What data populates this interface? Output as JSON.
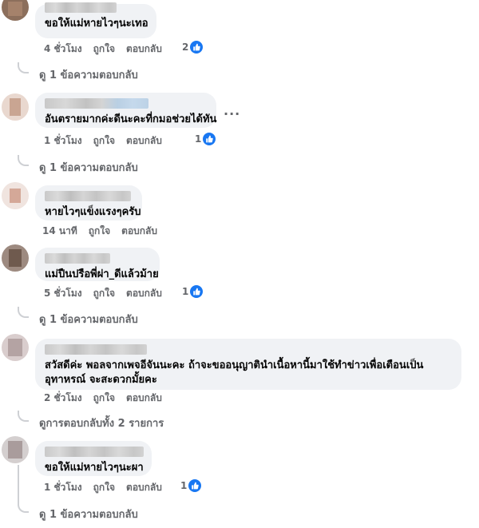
{
  "comments": [
    {
      "text": "ขอให้แม่หายไวๆนะเทอ",
      "time": "4 ชั่วโมง",
      "like": "ถูกใจ",
      "reply": "ตอบกลับ",
      "reaction_count": "2",
      "view_replies": "ดู 1 ข้อความตอบกลับ"
    },
    {
      "text": "อันตรายมากค่ะดีนะคะที่กมอช่วยได้ทัน",
      "time": "1 ชั่วโมง",
      "like": "ถูกใจ",
      "reply": "ตอบกลับ",
      "reaction_count": "1",
      "view_replies": "ดู 1 ข้อความตอบกลับ",
      "more": "···"
    },
    {
      "text": "หายไวๆแข็งแรงๆครับ",
      "time": "14 นาที",
      "like": "ถูกใจ",
      "reply": "ตอบกลับ"
    },
    {
      "text": "แม่ปืนปรือพี่ผ่า_ดีแล้วม้าย",
      "time": "5 ชั่วโมง",
      "like": "ถูกใจ",
      "reply": "ตอบกลับ",
      "reaction_count": "1",
      "view_replies": "ดู 1 ข้อความตอบกลับ"
    },
    {
      "text": "สวัสดีค่ะ พอลจากเพจอีจันนะคะ ถ้าจะขออนุญาตินำเนื้อหานี้มาใช้ทำข่าวเพื่อเตือนเป็นอุทาหรณ์ จะสะดวกมั้ยคะ",
      "time": "2 ชั่วโมง",
      "like": "ถูกใจ",
      "reply": "ตอบกลับ",
      "view_replies": "ดูการตอบกลับทั้ง 2 รายการ"
    },
    {
      "text": "ขอให้แม่หายไวๆนะผา",
      "time": "1 ชั่วโมง",
      "like": "ถูกใจ",
      "reply": "ตอบกลับ",
      "reaction_count": "1",
      "view_replies": "ดู 1 ข้อความตอบกลับ"
    }
  ],
  "colors": {
    "bubble_bg": "#f0f2f5",
    "secondary_text": "#65676b",
    "like_blue": "#1877f2",
    "thread_line": "#ced0d4"
  },
  "icons": {
    "reaction": "like-thumbs-up-icon",
    "reply_arrow": "reply-thread-curve"
  }
}
